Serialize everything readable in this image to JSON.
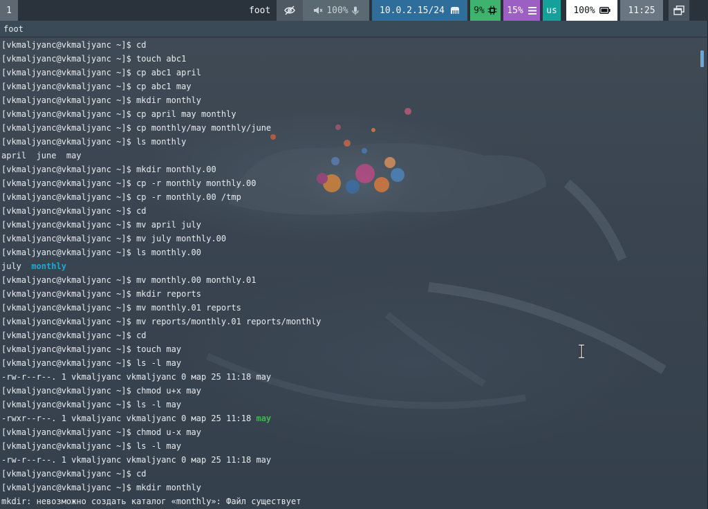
{
  "statusbar": {
    "workspace": "1",
    "app_name": "foot",
    "idle_icon": "eye-off-icon",
    "audio": {
      "speaker_icon": "speaker-muted-icon",
      "volume": "100%",
      "mic_icon": "microphone-icon"
    },
    "network": {
      "address": "10.0.2.15/24",
      "icon": "ethernet-icon"
    },
    "cpu": {
      "value": "9%",
      "icon": "cpu-chip-icon"
    },
    "memory": {
      "value": "15%",
      "icon": "memory-bars-icon"
    },
    "language": "us",
    "battery": {
      "value": "100%",
      "icon": "battery-full-icon"
    },
    "clock": "11:25",
    "tray_icon": "window-switcher-icon",
    "colors": {
      "network": "#2f6e9b",
      "cpu": "#3eb36f",
      "memory": "#9c5fc2",
      "language": "#13a19a",
      "battery": "#ffffff"
    }
  },
  "window": {
    "title": "foot"
  },
  "terminal": {
    "prompt": "[vkmaljyanc@vkmaljyanc ~]$",
    "colors": {
      "text": "#e8ecef",
      "directory": "#1fa8d6",
      "executable": "#3db84a"
    },
    "lines": [
      {
        "type": "cmd",
        "text": "cd"
      },
      {
        "type": "cmd",
        "text": "touch abc1"
      },
      {
        "type": "cmd",
        "text": "cp abc1 april"
      },
      {
        "type": "cmd",
        "text": "cp abc1 may"
      },
      {
        "type": "cmd",
        "text": "mkdir monthly"
      },
      {
        "type": "cmd",
        "text": "cp april may monthly"
      },
      {
        "type": "cmd",
        "text": "cp monthly/may monthly/june"
      },
      {
        "type": "cmd",
        "text": "ls monthly"
      },
      {
        "type": "out",
        "text": "april  june  may"
      },
      {
        "type": "cmd",
        "text": "mkdir monthly.00"
      },
      {
        "type": "cmd",
        "text": "cp -r monthly monthly.00"
      },
      {
        "type": "cmd",
        "text": "cp -r monthly.00 /tmp"
      },
      {
        "type": "cmd",
        "text": "cd"
      },
      {
        "type": "cmd",
        "text": "mv april july"
      },
      {
        "type": "cmd",
        "text": "mv july monthly.00"
      },
      {
        "type": "cmd",
        "text": "ls monthly.00"
      },
      {
        "type": "out",
        "text": "july  ",
        "hl": "monthly",
        "hl_class": "dir"
      },
      {
        "type": "cmd",
        "text": "mv monthly.00 monthly.01"
      },
      {
        "type": "cmd",
        "text": "mkdir reports"
      },
      {
        "type": "cmd",
        "text": "mv monthly.01 reports"
      },
      {
        "type": "cmd",
        "text": "mv reports/monthly.01 reports/monthly"
      },
      {
        "type": "cmd",
        "text": "cd"
      },
      {
        "type": "cmd",
        "text": "touch may"
      },
      {
        "type": "cmd",
        "text": "ls -l may"
      },
      {
        "type": "out",
        "text": "-rw-r--r--. 1 vkmaljyanc vkmaljyanc 0 мар 25 11:18 may"
      },
      {
        "type": "cmd",
        "text": "chmod u+x may"
      },
      {
        "type": "cmd",
        "text": "ls -l may"
      },
      {
        "type": "out",
        "text": "-rwxr--r--. 1 vkmaljyanc vkmaljyanc 0 мар 25 11:18 ",
        "hl": "may",
        "hl_class": "exe"
      },
      {
        "type": "cmd",
        "text": "chmod u-x may"
      },
      {
        "type": "cmd",
        "text": "ls -l may"
      },
      {
        "type": "out",
        "text": "-rw-r--r--. 1 vkmaljyanc vkmaljyanc 0 мар 25 11:18 may"
      },
      {
        "type": "cmd",
        "text": "cd"
      },
      {
        "type": "cmd",
        "text": "mkdir monthly"
      },
      {
        "type": "out",
        "text": "mkdir: невозможно создать каталог «monthly»: Файл существует"
      }
    ]
  }
}
